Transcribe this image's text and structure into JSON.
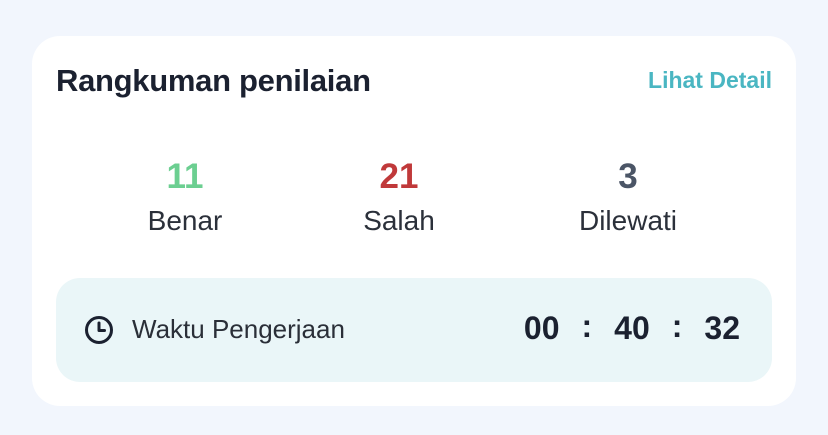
{
  "summary": {
    "title": "Rangkuman penilaian",
    "detail_link": "Lihat Detail"
  },
  "stats": {
    "correct": {
      "value": "11",
      "label": "Benar",
      "color": "#6ccf91"
    },
    "wrong": {
      "value": "21",
      "label": "Salah",
      "color": "#c0393a"
    },
    "skipped": {
      "value": "3",
      "label": "Dilewati",
      "color": "#4b5566"
    }
  },
  "timer": {
    "icon": "clock-icon",
    "label": "Waktu Pengerjaan",
    "hours": "00",
    "minutes": "40",
    "seconds": "32",
    "separator": ":"
  },
  "colors": {
    "accent": "#4ab6c2",
    "timer_background": "#eaf6f8",
    "page_background": "#f2f6fd"
  }
}
